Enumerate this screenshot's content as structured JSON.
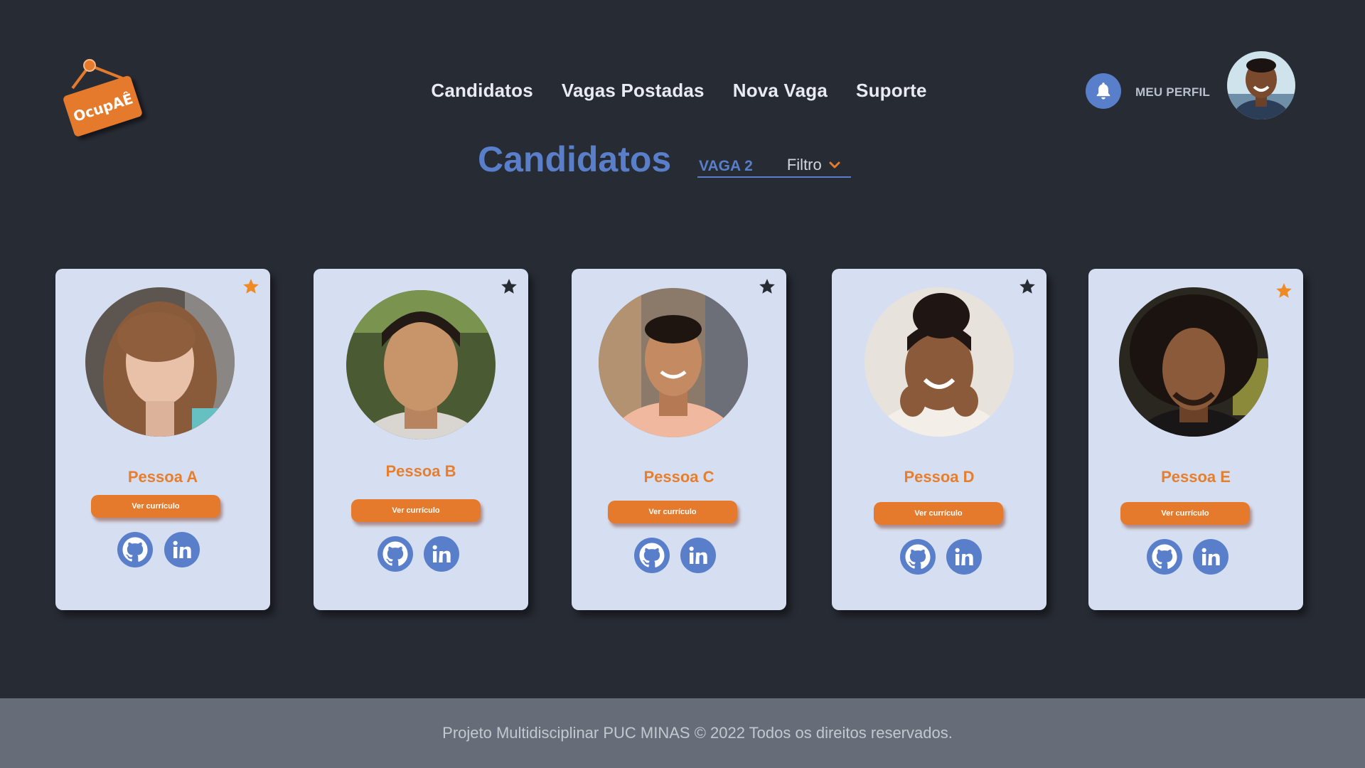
{
  "brand": {
    "logo_text": "OcupAÊ"
  },
  "nav": {
    "items": [
      {
        "label": "Candidatos"
      },
      {
        "label": "Vagas Postadas"
      },
      {
        "label": "Nova Vaga"
      },
      {
        "label": "Suporte"
      }
    ]
  },
  "header": {
    "profile_label": "MEU PERFIL",
    "bell_icon": "bell-icon"
  },
  "title": "Candidatos",
  "filter": {
    "selected_vaga": "VAGA 2",
    "label": "Filtro"
  },
  "colors": {
    "background": "#272b34",
    "accent_blue": "#5a7fca",
    "accent_orange": "#e57a2c",
    "card_bg": "#d6dff1",
    "footer_bg": "#676d78",
    "star_favorite": "#f08a24",
    "star_default": "#272b34"
  },
  "candidates": [
    {
      "name": "Pessoa A",
      "cv_label": "Ver currículo",
      "favorite": true
    },
    {
      "name": "Pessoa B",
      "cv_label": "Ver currículo",
      "favorite": false
    },
    {
      "name": "Pessoa C",
      "cv_label": "Ver currículo",
      "favorite": false
    },
    {
      "name": "Pessoa D",
      "cv_label": "Ver currículo",
      "favorite": false
    },
    {
      "name": "Pessoa E",
      "cv_label": "Ver currículo",
      "favorite": true
    }
  ],
  "footer": {
    "text": "Projeto Multidisciplinar  PUC MINAS © 2022 Todos os direitos reservados."
  }
}
